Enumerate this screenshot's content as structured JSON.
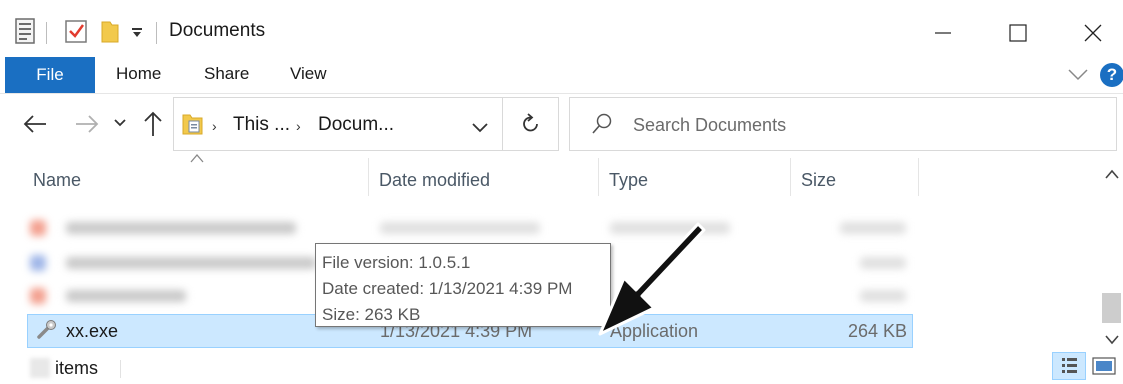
{
  "window": {
    "title": "Documents",
    "controls": {
      "minimize": "minimize",
      "maximize": "maximize",
      "close": "close"
    }
  },
  "ribbon": {
    "tabs": [
      "File",
      "Home",
      "Share",
      "View"
    ],
    "help_label": "?"
  },
  "address": {
    "crumbs": [
      "This ...",
      "Docum..."
    ],
    "search_placeholder": "Search Documents"
  },
  "columns": [
    "Name",
    "Date modified",
    "Type",
    "Size"
  ],
  "selected_file": {
    "name": "xx.exe",
    "date_modified": "1/13/2021 4:39 PM",
    "type": "Application",
    "size": "264 KB"
  },
  "tooltip": {
    "line1": "File version: 1.0.5.1",
    "line2": "Date created: 1/13/2021 4:39 PM",
    "line3": "Size: 263 KB"
  },
  "status": {
    "items_label": "items"
  },
  "colors": {
    "accent": "#1a6fc2",
    "selection": "#cce8ff",
    "selection_border": "#99d1ff"
  }
}
